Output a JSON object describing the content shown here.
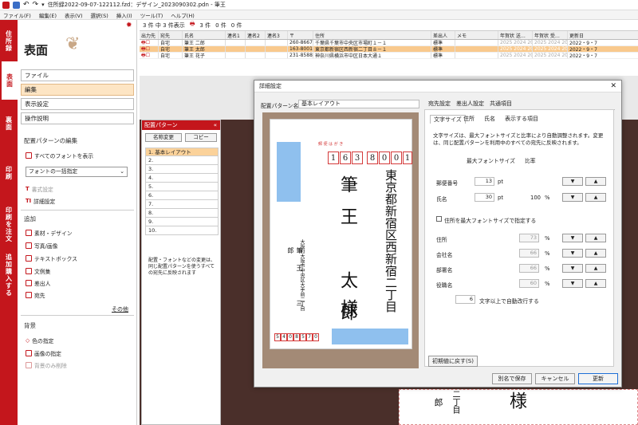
{
  "window": {
    "title": "住所録2022-09-07-122112.fzd：デザイン_2023090302.pdn - 筆王"
  },
  "menu": [
    "ファイル(F)",
    "編集(E)",
    "表示(V)",
    "選択(S)",
    "挿入(I)",
    "ツール(T)",
    "ヘルプ(H)"
  ],
  "vtabs": [
    "住所録",
    "表面",
    "裏面",
    "印刷",
    "印刷を注文",
    "追加購入する"
  ],
  "side": {
    "title": "表面",
    "buttons": [
      "ファイル",
      "編集",
      "表示設定",
      "操作説明"
    ],
    "section1": "配置パターンの編集",
    "show_all_fonts": "すべてのフォントを表示",
    "font_dropdown": "フォントの一括指定",
    "style_setting": "書式設定",
    "detail_setting": "詳細設定",
    "section2": "追加",
    "add_items": [
      "素材・デザイン",
      "写真/画像",
      "テキストボックス",
      "文例集",
      "差出人",
      "宛先"
    ],
    "other": "その他",
    "section3": "背景",
    "bg_items": [
      "色の指定",
      "画像の指定",
      "背景のみ削除"
    ]
  },
  "toolbar": {
    "summary": "3 件 中 3 件表示",
    "print_count": "3 件",
    "print_count2": "0 件",
    "print_count3": "0 件"
  },
  "grid": {
    "headers": [
      "出力先",
      "宛先",
      "氏名",
      "連名1",
      "連名2",
      "連名3",
      "〒",
      "住所",
      "差出人",
      "メモ",
      "年賀状 送…",
      "年賀状 受…",
      "更新日"
    ],
    "rows": [
      {
        "dest": "自宅",
        "name": "筆王 二郎",
        "zip": "260-8667",
        "addr": "千葉県千葉市中央区市場町１－１",
        "sender": "標準",
        "sent": "2025 2024 20",
        "upd": "2022・9・7"
      },
      {
        "dest": "自宅",
        "name": "筆王 太郎",
        "zip": "163-8001",
        "addr": "東京都新宿区西新宿二丁目８－１",
        "sender": "標準",
        "sent": "2025 2024 20",
        "upd": "2022・9・7"
      },
      {
        "dest": "自宅",
        "name": "筆王 花子",
        "zip": "231-8588",
        "addr": "神奈川県横浜市中区日本大通１",
        "sender": "標準",
        "sent": "2025 2024 20",
        "upd": "2022・9・7"
      }
    ]
  },
  "panel": {
    "title": "配置パターン",
    "rename": "名称変更",
    "copy": "コピー",
    "items": [
      "1. 基本レイアウト",
      "2.",
      "3.",
      "4.",
      "5.",
      "6.",
      "7.",
      "8.",
      "9.",
      "10."
    ],
    "note": "配置・フォントなどの変更は、同じ配置パターンを使うすべての宛先に反映されます"
  },
  "dialog": {
    "title": "詳細設定",
    "close": "✕",
    "pattern_label": "配置パターン名",
    "pattern_value": "基本レイアウト",
    "tabs_top": [
      "宛先設定",
      "差出人設定",
      "共通項目"
    ],
    "tabs_sub": [
      "文字サイズ",
      "住所",
      "氏名",
      "表示する項目"
    ],
    "desc": "文字サイズは、最大フォントサイズと比率により自動調整されます。変更は、同じ配置パターンを利用中のすべての宛先に反映されます。",
    "max_font": "最大フォントサイズ",
    "ratio": "比率",
    "zip_label": "郵便番号",
    "zip_size": "13",
    "pt": "pt",
    "name_label": "氏名",
    "name_size": "30",
    "name_ratio": "100",
    "pct": "%",
    "checkbox": "住所を最大フォントサイズで指定する",
    "addr_label": "住所",
    "addr_ratio": "73",
    "company_label": "会社名",
    "company_ratio": "66",
    "dept_label": "部署名",
    "dept_ratio": "66",
    "title_label": "役職名",
    "title_ratio": "60",
    "wrap_value": "6",
    "wrap_text": "文字以上で自動改行する",
    "reset": "初期値に戻す(S)",
    "save_as": "別名で保存",
    "cancel": "キャンセル",
    "ok": "更新"
  },
  "postcard": {
    "header": "郵 便 は が き",
    "zip": [
      "1",
      "6",
      "3",
      "8",
      "0",
      "0",
      "1"
    ],
    "address": "東京都新宿区西新宿二丁目",
    "name": "筆王　太郎",
    "sama": "様",
    "sender_addr": "大阪府大阪市中央区大手前二丁目",
    "sender_name": "筆王　三郎",
    "sender_zip": [
      "5",
      "4",
      "0",
      "8",
      "5",
      "7",
      "0"
    ]
  },
  "background_preview": {
    "sama": "様",
    "col1": "二丁目",
    "col2": "郎"
  },
  "colors": {
    "brand_red": "#c4161c",
    "selection": "#fde5c4",
    "accent_blue": "#1e6fd6"
  }
}
